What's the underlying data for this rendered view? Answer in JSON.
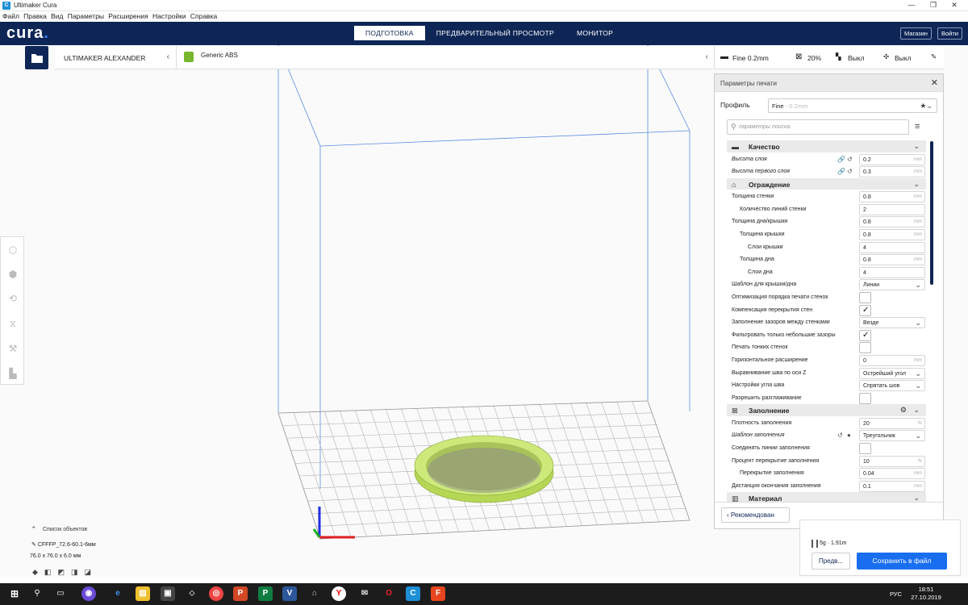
{
  "window": {
    "title": "Ultimaker Cura"
  },
  "menu": [
    "Файл",
    "Правка",
    "Вид",
    "Параметры",
    "Расширения",
    "Настройки",
    "Справка"
  ],
  "header": {
    "logo": "cura",
    "stages": [
      "ПОДГОТОВКА",
      "ПРЕДВАРИТЕЛЬНЫЙ ПРОСМОТР",
      "МОНИТОР"
    ],
    "active_stage": "ПОДГОТОВКА",
    "marketplace": "Магазин",
    "signin": "Войти"
  },
  "printer": {
    "name": "ULTIMAKER ALEXANDER"
  },
  "material": {
    "name": "Generic ABS"
  },
  "print_summary": {
    "profile": "Fine 0.2mm",
    "infill": "20%",
    "support": "Выкл",
    "adhesion": "Выкл"
  },
  "panel": {
    "title": "Параметры печати",
    "profile_label": "Профиль",
    "profile_value": "Fine",
    "profile_value_dim": "- 0.2mm",
    "search_placeholder": "параметры поиска",
    "recommended": "Рекомендован"
  },
  "settings": {
    "quality": {
      "label": "Качество",
      "rows": [
        {
          "label": "Высота слоя",
          "value": "0.2",
          "unit": "mm"
        },
        {
          "label": "Высота первого слоя",
          "value": "0.3",
          "unit": "mm"
        }
      ]
    },
    "shell": {
      "label": "Ограждение",
      "rows": [
        {
          "label": "Толщина стенки",
          "value": "0.8",
          "unit": "mm"
        },
        {
          "label": "Количество линий стенки",
          "value": "2",
          "unit": ""
        },
        {
          "label": "Толщина дна/крышки",
          "value": "0.8",
          "unit": "mm"
        },
        {
          "label": "Толщина крышки",
          "value": "0.8",
          "unit": "mm"
        },
        {
          "label": "Слои крышки",
          "value": "4",
          "unit": ""
        },
        {
          "label": "Толщина дна",
          "value": "0.8",
          "unit": "mm"
        },
        {
          "label": "Слои дна",
          "value": "4",
          "unit": ""
        },
        {
          "label": "Шаблон для крышки/дна",
          "value": "Линии"
        },
        {
          "label": "Оптимизация порядка печати стенок"
        },
        {
          "label": "Компенсация перекрытия стен"
        },
        {
          "label": "Заполнение зазоров между стенками",
          "value": "Везде"
        },
        {
          "label": "Фильтровать только небольшие зазоры"
        },
        {
          "label": "Печать тонких стенок"
        },
        {
          "label": "Горизонтальное расширение",
          "value": "0",
          "unit": "mm"
        },
        {
          "label": "Выравнивание шва по оси Z",
          "value": "Острейший угол"
        },
        {
          "label": "Настройки угла шва",
          "value": "Спрятать шов"
        },
        {
          "label": "Разрешить разглаживание"
        }
      ]
    },
    "infill": {
      "label": "Заполнение",
      "rows": [
        {
          "label": "Плотность заполнения",
          "value": "20",
          "unit": "%"
        },
        {
          "label": "Шаблон заполнения",
          "value": "Треугольник"
        },
        {
          "label": "Соединять линии заполнения"
        },
        {
          "label": "Процент перекрытие заполнения",
          "value": "10",
          "unit": "%"
        },
        {
          "label": "Перекрытие заполнения",
          "value": "0.04",
          "unit": "mm"
        },
        {
          "label": "Дистанция окончания заполнения",
          "value": "0.1",
          "unit": "mm"
        }
      ]
    },
    "material": {
      "label": "Материал"
    }
  },
  "object_list": {
    "title": "Список объектов",
    "object_name": "CFFFP_72.6-60.1-6мм",
    "dimensions": "76.0 x 76.0 x 6.0 мм"
  },
  "action": {
    "material_use": "5g · 1.91m",
    "preview": "Предв...",
    "save": "Сохранить в файл"
  },
  "taskbar": {
    "lang": "РУС",
    "time": "18:51",
    "date": "27.10.2019"
  },
  "colors": {
    "header": "#0e2656",
    "accent": "#196ef0",
    "model": "#c9e86c"
  }
}
